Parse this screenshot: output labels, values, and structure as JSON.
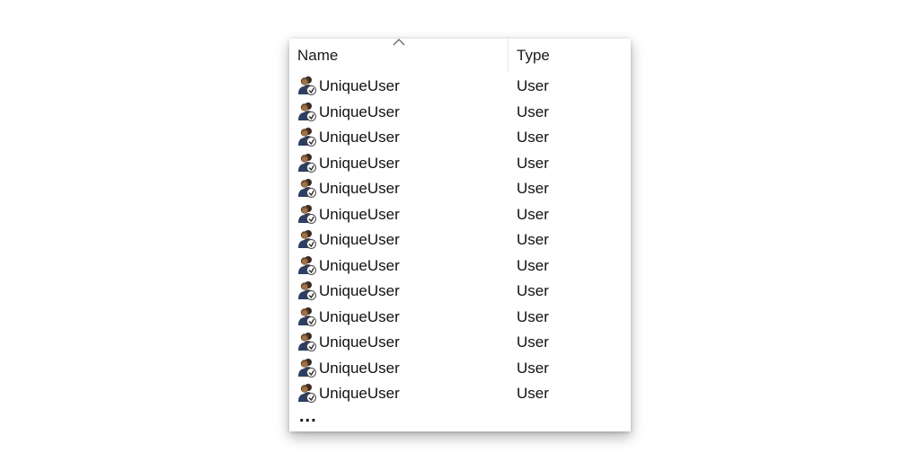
{
  "list": {
    "columns": {
      "name": "Name",
      "type": "Type"
    },
    "sort": {
      "column": "name",
      "direction": "ascending",
      "icon": "sort-up-icon"
    },
    "row_icon": "user-icon",
    "rows": [
      {
        "name": "UniqueUser",
        "type": "User"
      },
      {
        "name": "UniqueUser",
        "type": "User"
      },
      {
        "name": "UniqueUser",
        "type": "User"
      },
      {
        "name": "UniqueUser",
        "type": "User"
      },
      {
        "name": "UniqueUser",
        "type": "User"
      },
      {
        "name": "UniqueUser",
        "type": "User"
      },
      {
        "name": "UniqueUser",
        "type": "User"
      },
      {
        "name": "UniqueUser",
        "type": "User"
      },
      {
        "name": "UniqueUser",
        "type": "User"
      },
      {
        "name": "UniqueUser",
        "type": "User"
      },
      {
        "name": "UniqueUser",
        "type": "User"
      },
      {
        "name": "UniqueUser",
        "type": "User"
      },
      {
        "name": "UniqueUser",
        "type": "User"
      }
    ],
    "more_text": "..."
  }
}
